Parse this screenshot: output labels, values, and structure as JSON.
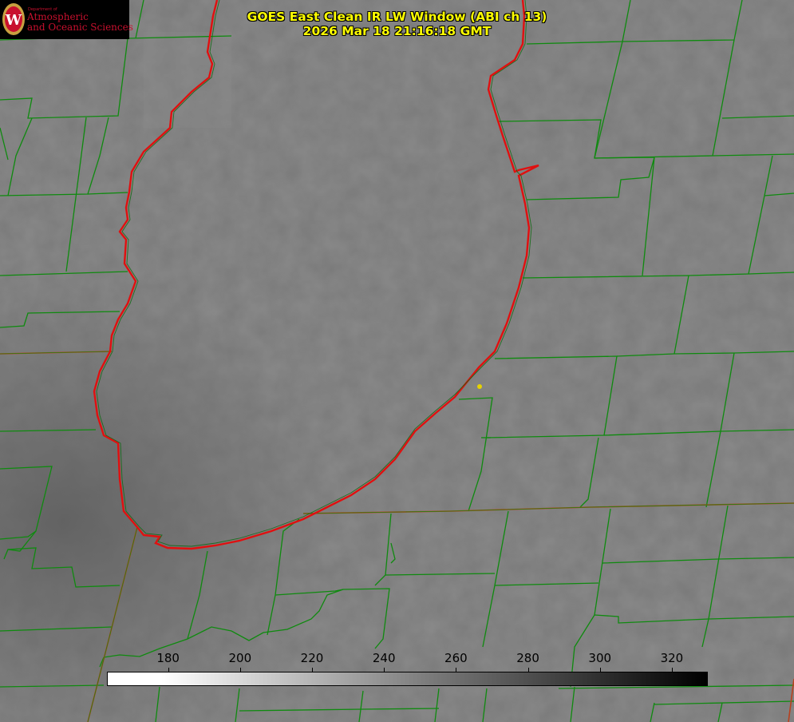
{
  "logo": {
    "department": "Department of",
    "line1": "Atmospheric",
    "line2": "and Oceanic Sciences",
    "seal_letter": "W"
  },
  "title": {
    "line1": "GOES East Clean IR LW Window (ABI ch 13)",
    "line2": "2026 Mar 18 21:16:18 GMT"
  },
  "colorbar": {
    "min": 163,
    "max": 330,
    "ticks": [
      "180",
      "200",
      "220",
      "240",
      "260",
      "280",
      "300",
      "320"
    ],
    "unit_note": "brightness temperature (K), white = cold, black = warm"
  },
  "colors": {
    "lake_outline": "#e01010",
    "county_lines": "#0f8a0f",
    "state_lines": "#b8401e",
    "title_text": "#ffff00",
    "marker": "#e6d200"
  },
  "map": {
    "features": [
      "lake-michigan",
      "county-boundaries",
      "state-boundaries",
      "station-marker"
    ]
  }
}
